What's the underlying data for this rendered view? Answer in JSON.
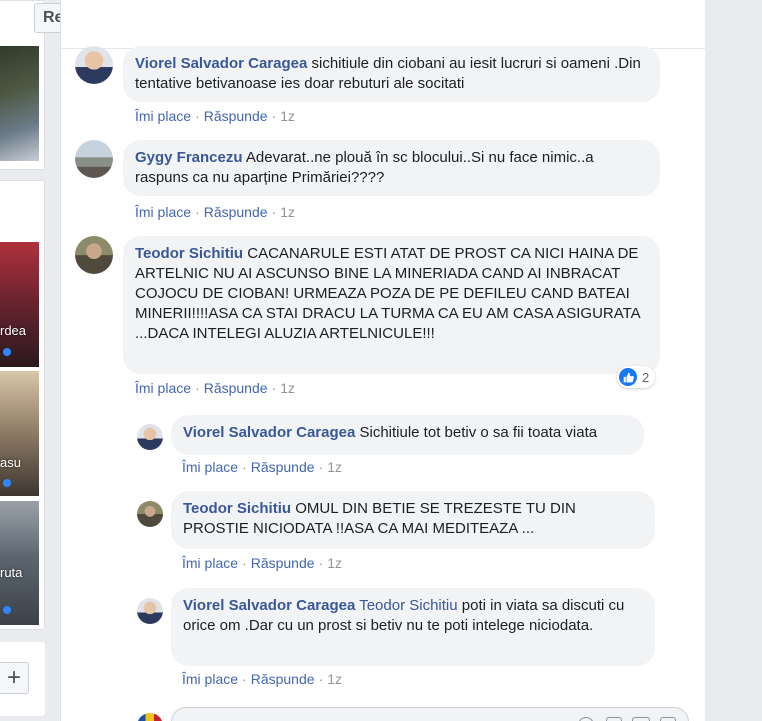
{
  "filters": {
    "partial_label": "e",
    "recent_label": "Recente"
  },
  "sidebar": {
    "items": [
      {
        "label": ""
      },
      {
        "label": "rdea"
      },
      {
        "label": "asu"
      },
      {
        "label": "ruta"
      }
    ],
    "plus_label": "+"
  },
  "actions": {
    "like": "Îmi place",
    "reply": "Răspunde",
    "separator": "·"
  },
  "comments": [
    {
      "author": "Viorel Salvador Caragea",
      "text": "sichitiule din ciobani au iesit lucruri si oameni .Din tentative betivanoase ies doar rebuturi ale socitati",
      "time": "1z"
    },
    {
      "author": "Gygy Francezu",
      "text": "Adevarat..ne plouă în sc blocului..Si nu face nimic..a raspuns ca nu aparține Primăriei????",
      "time": "1z"
    },
    {
      "author": "Teodor Sichitiu",
      "text": "CACANARULE ESTI ATAT DE PROST CA NICI HAINA DE ARTELNIC NU AI ASCUNSO BINE LA MINERIADA CAND AI INBRACAT COJOCU DE CIOBAN! URMEAZA POZA DE PE DEFILEU CAND BATEAI MINERII!!!!ASA CA STAI DRACU LA TURMA CA EU AM CASA ASIGURATA ...DACA INTELEGI ALUZIA ARTELNICULE!!!",
      "time": "1z",
      "reaction_count": "2"
    }
  ],
  "replies": [
    {
      "author": "Viorel Salvador Caragea",
      "text": "Sichitiule tot betiv o sa fii toata viata",
      "time": "1z"
    },
    {
      "author": "Teodor Sichitiu",
      "text": "OMUL DIN BETIE SE TREZESTE TU DIN PROSTIE NICIODATA !!ASA CA MAI MEDITEAZA ...",
      "time": "1z"
    },
    {
      "author": "Viorel Salvador Caragea",
      "mention": "Teodor Sichitiu",
      "text": "poti in viata sa discuti cu orice om .Dar cu un prost si betiv nu te poti intelege niciodata.",
      "time": "1z"
    }
  ],
  "colors": {
    "author": "#385898",
    "link": "#4267b2",
    "bubble": "#f2f3f5",
    "like_blue": "#1877f2"
  }
}
